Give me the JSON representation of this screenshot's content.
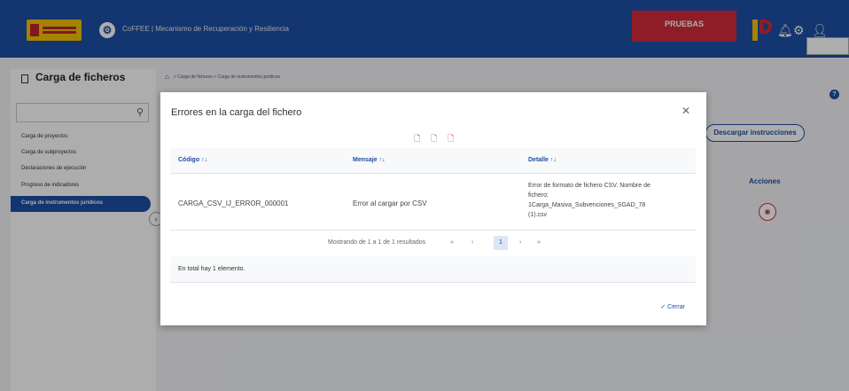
{
  "header": {
    "app_name": "CoFFEE",
    "separator": "|",
    "subtitle": "Mecanismo de Recuperación y Resiliencia",
    "env_badge": "PRUEBAS"
  },
  "sidebar": {
    "title": "Carga de ficheros",
    "search_placeholder": "",
    "items": [
      {
        "label": "Carga de proyectos"
      },
      {
        "label": "Carga de subproyectos"
      },
      {
        "label": "Declaraciones de ejecución"
      },
      {
        "label": "Progreso de indicadores"
      },
      {
        "label": "Carga de instrumentos jurídicos"
      }
    ],
    "active_index": 4
  },
  "main": {
    "breadcrumb": "> Carga de ficheros > Carga de instrumentos jurídicos",
    "download_button": "Descargar instrucciones",
    "actions_header": "Acciones"
  },
  "modal": {
    "title": "Errores en la carga del fichero",
    "columns": [
      {
        "label": "Código",
        "sort": "↑↓"
      },
      {
        "label": "Mensaje",
        "sort": "↑↓"
      },
      {
        "label": "Detalle",
        "sort": "↑↓"
      }
    ],
    "rows": [
      {
        "codigo": "CARGA_CSV_IJ_ERROR_000001",
        "mensaje": "Error al cargar por CSV",
        "detalle_lines": [
          "Error de formato de fichero CSV. Nombre de",
          "fichero:",
          "1Carga_Masiva_Subvenciones_SGAD_78",
          "(1).csv"
        ]
      }
    ],
    "pagination": {
      "summary": "Mostrando de 1 a 1 de 1 resultados",
      "first": "«",
      "prev": "‹",
      "current": "1",
      "next": "›",
      "last": "»"
    },
    "total_text": "En total hay 1 elemento.",
    "close_button": "✓ Cerrar"
  },
  "colors": {
    "primary": "#1d4fa5",
    "danger": "#d22c3c",
    "accent_yellow": "#f2c200"
  }
}
